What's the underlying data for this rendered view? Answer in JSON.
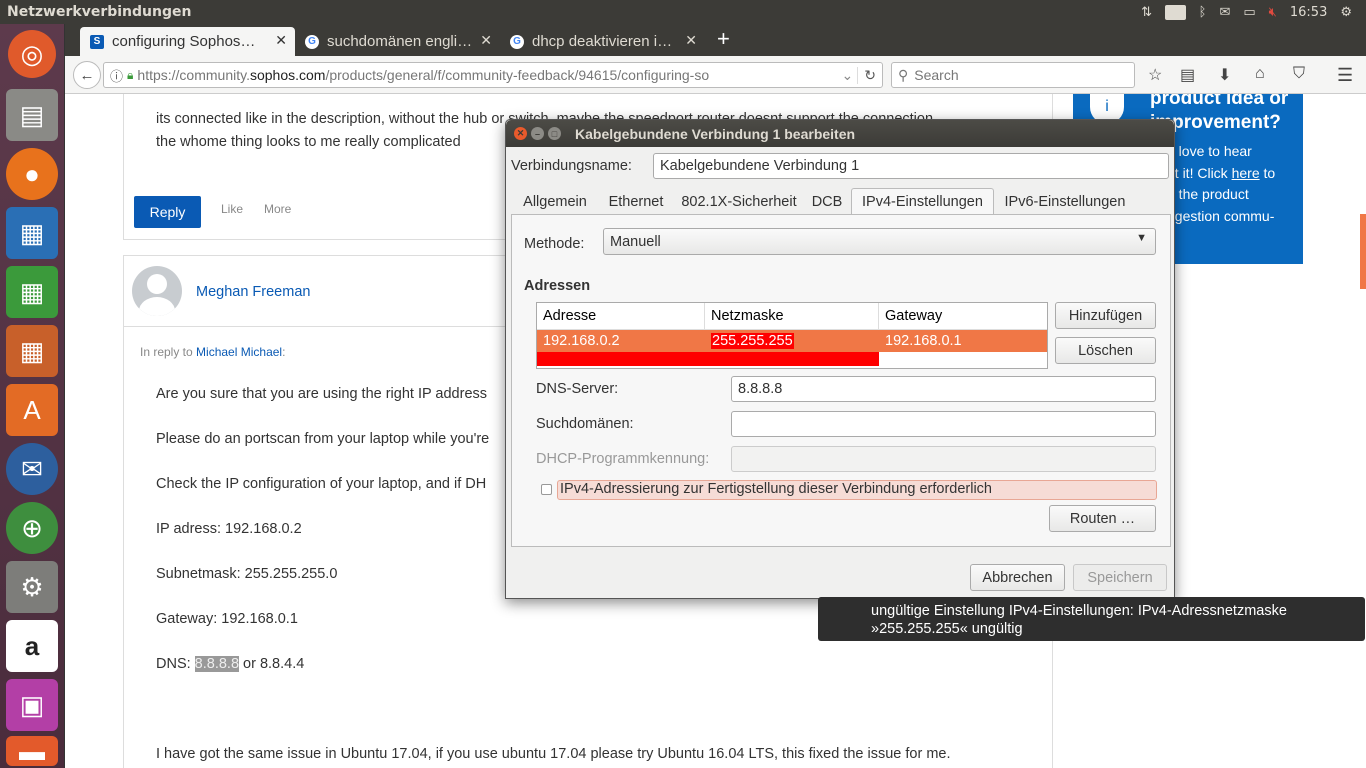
{
  "topbar": {
    "title": "Netzwerkverbindungen",
    "keyboard": "De",
    "time": "16:53"
  },
  "launcher": {
    "icons": [
      "ubuntu-icon",
      "files-icon",
      "firefox-icon",
      "writer-icon",
      "calc-icon",
      "impress-icon",
      "software-center-icon",
      "thunderbird-icon",
      "network-globe-icon",
      "system-settings-icon",
      "amazon-icon",
      "network-connections-icon",
      "drawer-icon"
    ]
  },
  "browser": {
    "tabs": [
      {
        "label": "configuring Sophos…",
        "favicon": "S",
        "active": true
      },
      {
        "label": "suchdomänen engli…",
        "favicon": "G",
        "active": false
      },
      {
        "label": "dhcp deaktivieren i…",
        "favicon": "G",
        "active": false
      }
    ],
    "new_tab": "+",
    "url_prefix": "https://community.",
    "url_domain": "sophos.com",
    "url_path": "/products/general/f/community-feedback/94615/configuring-so",
    "search_placeholder": "Search"
  },
  "page": {
    "post1_line1": "its connected like in the description, without the hub or switch, maybe the speedport router doesnt support the connection",
    "post1_line2": "the whome thing looks to me really complicated",
    "reply": "Reply",
    "like": "Like",
    "more": "More",
    "author": "Meghan Freeman",
    "in_reply_prefix": "In reply to",
    "in_reply_user": "Michael Michael",
    "in_reply_colon": ":",
    "lines": [
      "Are you sure that you are using the right IP address",
      "Please do an portscan from your laptop while you're",
      "Check the IP configuration of your laptop, and if DH",
      "IP adress: 192.168.0.2",
      "Subnetmask: 255.255.255.0",
      "Gateway: 192.168.0.1"
    ],
    "dns_label": "DNS: ",
    "dns_highlight": "8.8.8.8",
    "dns_rest": " or 8.8.4.4",
    "final_line": "I have got the same issue in Ubuntu 17.04, if you use ubuntu 17.04 please try Ubuntu 16.04 LTS, this fixed the issue for me.",
    "promo_title1": "product idea or",
    "promo_title2": "improvement?",
    "promo_line1": "d love to hear",
    "promo_line2a": "ut it! Click ",
    "promo_link": "here",
    "promo_line2b": " to",
    "promo_line3": "o the product",
    "promo_line4": "ggestion commu-"
  },
  "dialog": {
    "title": "Kabelgebundene Verbindung 1 bearbeiten",
    "name_label": "Verbindungsname:",
    "name_value": "Kabelgebundene Verbindung 1",
    "tabs": [
      "Allgemein",
      "Ethernet",
      "802.1X-Sicherheit",
      "DCB",
      "IPv4-Einstellungen",
      "IPv6-Einstellungen"
    ],
    "method_label": "Methode:",
    "method_value": "Manuell",
    "addresses_heading": "Adressen",
    "col_address": "Adresse",
    "col_netmask": "Netzmaske",
    "col_gateway": "Gateway",
    "row_address": "192.168.0.2",
    "row_netmask": "255.255.255",
    "row_gateway": "192.168.0.1",
    "add_button": "Hinzufügen",
    "delete_button": "Löschen",
    "dns_label": "DNS-Server:",
    "dns_value": "8.8.8.8",
    "search_label": "Suchdomänen:",
    "search_value": "",
    "dhcp_label": "DHCP-Programmkennung:",
    "dhcp_value": "",
    "require_ipv4_label": "IPv4-Adressierung zur Fertigstellung dieser Verbindung erforderlich",
    "routes_button": "Routen …",
    "cancel_button": "Abbrechen",
    "save_button": "Speichern"
  },
  "tooltip": {
    "line1": "ungültige Einstellung IPv4-Einstellungen: IPv4-Adressnetzmaske",
    "line2": "»255.255.255« ungültig"
  },
  "colors": {
    "accent_orange": "#f07746",
    "error_red": "#ff0000",
    "sophos_blue": "#0a5ab4"
  }
}
